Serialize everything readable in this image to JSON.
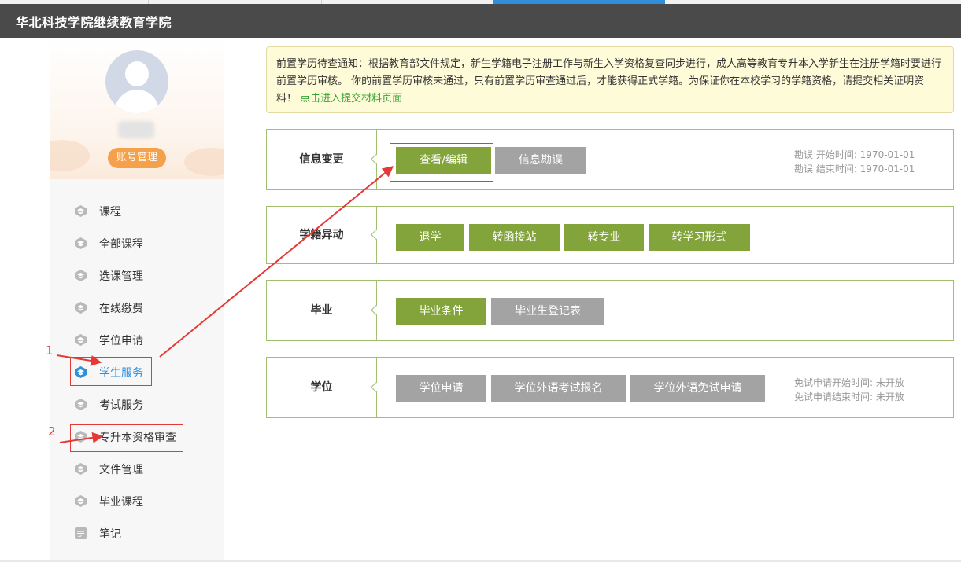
{
  "app": {
    "title": "华北科技学院继续教育学院"
  },
  "profile": {
    "account_button": "账号管理"
  },
  "nav": {
    "items": [
      {
        "label": "课程",
        "icon": "graduation-cap-icon"
      },
      {
        "label": "全部课程",
        "icon": "graduation-cap-icon"
      },
      {
        "label": "选课管理",
        "icon": "graduation-cap-icon"
      },
      {
        "label": "在线缴费",
        "icon": "graduation-cap-icon"
      },
      {
        "label": "学位申请",
        "icon": "graduation-cap-icon"
      },
      {
        "label": "学生服务",
        "icon": "graduation-cap-icon",
        "active": true
      },
      {
        "label": "考试服务",
        "icon": "graduation-cap-icon"
      },
      {
        "label": "专升本资格审查",
        "icon": "graduation-cap-icon"
      },
      {
        "label": "文件管理",
        "icon": "graduation-cap-icon"
      },
      {
        "label": "毕业课程",
        "icon": "graduation-cap-icon"
      },
      {
        "label": "笔记",
        "icon": "note-icon"
      }
    ]
  },
  "notice": {
    "text": "前置学历待查通知：根据教育部文件规定，新生学籍电子注册工作与新生入学资格复查同步进行，成人高等教育专升本入学新生在注册学籍时要进行前置学历审核。 你的前置学历审核未通过，只有前置学历审查通过后，才能获得正式学籍。为保证你在本校学习的学籍资格，请提交相关证明资料！",
    "link": "点击进入提交材料页面"
  },
  "sections": {
    "info_change": {
      "label": "信息变更",
      "buttons": [
        "查看/编辑",
        "信息勘误"
      ],
      "meta": [
        "勘误 开始时间: 1970-01-01",
        "勘误 结束时间: 1970-01-01"
      ]
    },
    "status_change": {
      "label": "学籍异动",
      "buttons": [
        "退学",
        "转函接站",
        "转专业",
        "转学习形式"
      ]
    },
    "graduation": {
      "label": "毕业",
      "buttons": [
        "毕业条件",
        "毕业生登记表"
      ]
    },
    "degree": {
      "label": "学位",
      "buttons": [
        "学位申请",
        "学位外语考试报名",
        "学位外语免试申请"
      ],
      "meta": [
        "免试申请开始时间: 未开放",
        "免试申请结束时间: 未开放"
      ]
    }
  },
  "annotations": {
    "marker_1": "1",
    "marker_2": "2"
  },
  "colors": {
    "header": "#4a4a4a",
    "green_button": "#82a43a",
    "gray_button": "#a3a3a3",
    "annotation": "#e53935",
    "active_nav": "#2f8fdb"
  }
}
